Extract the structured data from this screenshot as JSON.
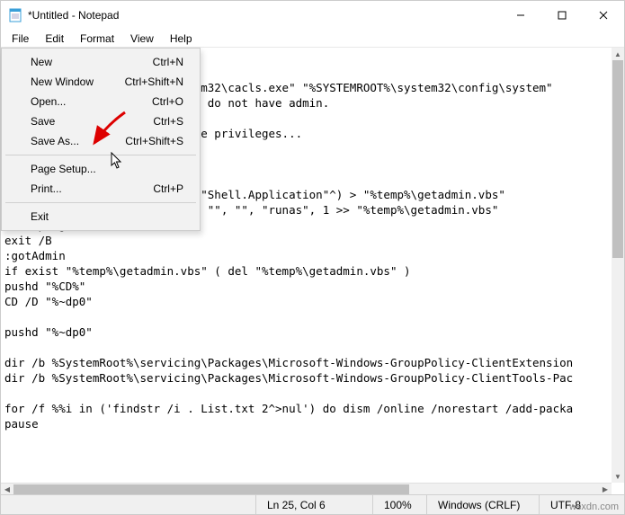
{
  "titlebar": {
    "title": "*Untitled - Notepad"
  },
  "menubar": {
    "items": [
      "File",
      "Edit",
      "Format",
      "View",
      "Help"
    ]
  },
  "dropdown": {
    "items": [
      {
        "label": "New",
        "shortcut": "Ctrl+N"
      },
      {
        "label": "New Window",
        "shortcut": "Ctrl+Shift+N"
      },
      {
        "label": "Open...",
        "shortcut": "Ctrl+O"
      },
      {
        "label": "Save",
        "shortcut": "Ctrl+S"
      },
      {
        "label": "Save As...",
        "shortcut": "Ctrl+Shift+S"
      },
      {
        "label": "Page Setup...",
        "shortcut": ""
      },
      {
        "label": "Print...",
        "shortcut": "Ctrl+P"
      },
      {
        "label": "Exit",
        "shortcut": ""
      }
    ]
  },
  "editor": {
    "text": "\n\n                            em32\\cacls.exe\" \"%SYSTEMROOT%\\system32\\config\\system\"\n                            e do not have admin.\n\n                            ve privileges...\n\n\n\n                            (\"Shell.Application\"^) > \"%temp%\\getadmin.vbs\"\n                            , \"\", \"\", \"runas\", 1 >> \"%temp%\\getadmin.vbs\"\n\"%temp%\\getadmin.vbs\"\nexit /B\n:gotAdmin\nif exist \"%temp%\\getadmin.vbs\" ( del \"%temp%\\getadmin.vbs\" )\npushd \"%CD%\"\nCD /D \"%~dp0\"\n\npushd \"%~dp0\"\n\ndir /b %SystemRoot%\\servicing\\Packages\\Microsoft-Windows-GroupPolicy-ClientExtension\ndir /b %SystemRoot%\\servicing\\Packages\\Microsoft-Windows-GroupPolicy-ClientTools-Pac\n\nfor /f %%i in ('findstr /i . List.txt 2^>nul') do dism /online /norestart /add-packa\npause"
  },
  "statusbar": {
    "position": "Ln 25, Col 6",
    "zoom": "100%",
    "eol": "Windows (CRLF)",
    "encoding": "UTF-8"
  },
  "watermark": "wsxdn.com"
}
